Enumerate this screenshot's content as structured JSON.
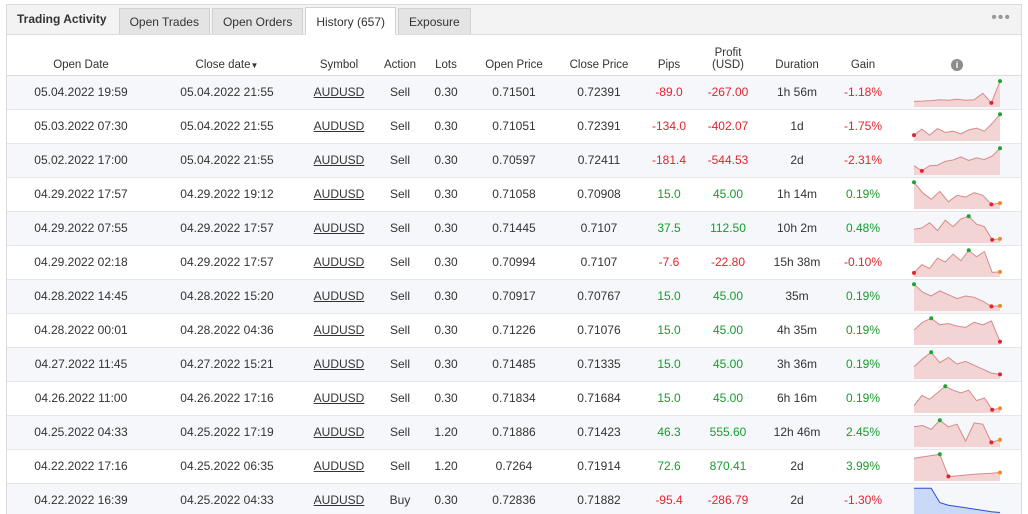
{
  "header": {
    "title": "Trading Activity",
    "tabs": [
      {
        "label": "Open Trades"
      },
      {
        "label": "Open Orders"
      },
      {
        "label": "History (657)"
      },
      {
        "label": "Exposure"
      }
    ],
    "menu_icon": "ellipsis-icon",
    "menu_glyph": "•••"
  },
  "table": {
    "columns": {
      "open_date": "Open Date",
      "close_date": "Close date",
      "sort_glyph": "▼",
      "symbol": "Symbol",
      "action": "Action",
      "lots": "Lots",
      "open_price": "Open Price",
      "close_price": "Close Price",
      "pips": "Pips",
      "profit_line1": "Profit",
      "profit_line2": "(USD)",
      "duration": "Duration",
      "gain": "Gain",
      "info_glyph": "i"
    },
    "rows": [
      {
        "open": "05.04.2022 19:59",
        "close": "05.04.2022 21:55",
        "symbol": "AUDUSD",
        "action": "Sell",
        "lots": "0.30",
        "open_price": "0.71501",
        "close_price": "0.72391",
        "pips": "-89.0",
        "profit": "-267.00",
        "duration": "1h 56m",
        "gain": "-1.18%",
        "positive": false,
        "spark": [
          0.86,
          0.85,
          0.83,
          0.8,
          0.82,
          0.78,
          0.82,
          0.8,
          0.55,
          0.92,
          0.08
        ]
      },
      {
        "open": "05.03.2022 07:30",
        "close": "05.04.2022 21:55",
        "symbol": "AUDUSD",
        "action": "Sell",
        "lots": "0.30",
        "open_price": "0.71051",
        "close_price": "0.72391",
        "pips": "-134.0",
        "profit": "-402.07",
        "duration": "1d",
        "gain": "-1.75%",
        "positive": false,
        "spark": [
          0.85,
          0.62,
          0.85,
          0.6,
          0.75,
          0.7,
          0.8,
          0.65,
          0.58,
          0.7,
          0.4,
          0.05
        ]
      },
      {
        "open": "05.02.2022 17:00",
        "close": "05.04.2022 21:55",
        "symbol": "AUDUSD",
        "action": "Sell",
        "lots": "0.30",
        "open_price": "0.70597",
        "close_price": "0.72411",
        "pips": "-181.4",
        "profit": "-544.53",
        "duration": "2d",
        "gain": "-2.31%",
        "positive": false,
        "spark": [
          0.72,
          0.92,
          0.72,
          0.7,
          0.55,
          0.5,
          0.38,
          0.52,
          0.42,
          0.48,
          0.35,
          0.05
        ]
      },
      {
        "open": "04.29.2022 17:57",
        "close": "04.29.2022 19:12",
        "symbol": "AUDUSD",
        "action": "Sell",
        "lots": "0.30",
        "open_price": "0.71058",
        "close_price": "0.70908",
        "pips": "15.0",
        "profit": "45.00",
        "duration": "1h 14m",
        "gain": "0.19%",
        "positive": true,
        "spark": [
          0.05,
          0.45,
          0.7,
          0.4,
          0.8,
          0.55,
          0.62,
          0.45,
          0.55,
          0.9,
          0.85
        ]
      },
      {
        "open": "04.29.2022 07:55",
        "close": "04.29.2022 17:57",
        "symbol": "AUDUSD",
        "action": "Sell",
        "lots": "0.30",
        "open_price": "0.71445",
        "close_price": "0.7107",
        "pips": "37.5",
        "profit": "112.50",
        "duration": "10h 2m",
        "gain": "0.48%",
        "positive": true,
        "spark": [
          0.55,
          0.5,
          0.3,
          0.6,
          0.2,
          0.45,
          0.15,
          0.05,
          0.35,
          0.45,
          0.95,
          0.92
        ]
      },
      {
        "open": "04.29.2022 02:18",
        "close": "04.29.2022 17:57",
        "symbol": "AUDUSD",
        "action": "Sell",
        "lots": "0.30",
        "open_price": "0.70994",
        "close_price": "0.7107",
        "pips": "-7.6",
        "profit": "-22.80",
        "duration": "15h 38m",
        "gain": "-0.10%",
        "positive": false,
        "spark": [
          0.92,
          0.6,
          0.75,
          0.35,
          0.5,
          0.2,
          0.45,
          0.05,
          0.3,
          0.1,
          0.9,
          0.88
        ]
      },
      {
        "open": "04.28.2022 14:45",
        "close": "04.28.2022 15:20",
        "symbol": "AUDUSD",
        "action": "Sell",
        "lots": "0.30",
        "open_price": "0.70917",
        "close_price": "0.70767",
        "pips": "15.0",
        "profit": "45.00",
        "duration": "35m",
        "gain": "0.19%",
        "positive": true,
        "spark": [
          0.05,
          0.35,
          0.5,
          0.3,
          0.45,
          0.6,
          0.5,
          0.55,
          0.7,
          0.9,
          0.88
        ]
      },
      {
        "open": "04.28.2022 00:01",
        "close": "04.28.2022 04:36",
        "symbol": "AUDUSD",
        "action": "Sell",
        "lots": "0.30",
        "open_price": "0.71226",
        "close_price": "0.71076",
        "pips": "15.0",
        "profit": "45.00",
        "duration": "4h 35m",
        "gain": "0.19%",
        "positive": true,
        "spark": [
          0.5,
          0.2,
          0.05,
          0.3,
          0.25,
          0.35,
          0.4,
          0.2,
          0.3,
          0.15,
          0.95
        ]
      },
      {
        "open": "04.27.2022 11:45",
        "close": "04.27.2022 15:21",
        "symbol": "AUDUSD",
        "action": "Sell",
        "lots": "0.30",
        "open_price": "0.71485",
        "close_price": "0.71335",
        "pips": "15.0",
        "profit": "45.00",
        "duration": "3h 36m",
        "gain": "0.19%",
        "positive": true,
        "spark": [
          0.6,
          0.3,
          0.05,
          0.45,
          0.25,
          0.5,
          0.4,
          0.55,
          0.7,
          0.85,
          0.9
        ]
      },
      {
        "open": "04.26.2022 11:00",
        "close": "04.26.2022 17:16",
        "symbol": "AUDUSD",
        "action": "Sell",
        "lots": "0.30",
        "open_price": "0.71834",
        "close_price": "0.71684",
        "pips": "15.0",
        "profit": "45.00",
        "duration": "6h 16m",
        "gain": "0.19%",
        "positive": true,
        "spark": [
          0.8,
          0.4,
          0.55,
          0.3,
          0.05,
          0.2,
          0.3,
          0.2,
          0.6,
          0.5,
          0.95,
          0.9
        ]
      },
      {
        "open": "04.25.2022 04:33",
        "close": "04.25.2022 17:19",
        "symbol": "AUDUSD",
        "action": "Sell",
        "lots": "1.20",
        "open_price": "0.71886",
        "close_price": "0.71423",
        "pips": "46.3",
        "profit": "555.60",
        "duration": "12h 46m",
        "gain": "2.45%",
        "positive": true,
        "spark": [
          0.3,
          0.25,
          0.4,
          0.05,
          0.3,
          0.2,
          0.85,
          0.15,
          0.2,
          0.9,
          0.8
        ]
      },
      {
        "open": "04.22.2022 17:16",
        "close": "04.25.2022 06:35",
        "symbol": "AUDUSD",
        "action": "Sell",
        "lots": "1.20",
        "open_price": "0.7264",
        "close_price": "0.71914",
        "pips": "72.6",
        "profit": "870.41",
        "duration": "2d",
        "gain": "3.99%",
        "positive": true,
        "spark": [
          0.2,
          0.15,
          0.1,
          0.05,
          0.9,
          0.88,
          0.85,
          0.82,
          0.8,
          0.78,
          0.75
        ]
      },
      {
        "open": "04.22.2022 16:39",
        "close": "04.25.2022 04:33",
        "symbol": "AUDUSD",
        "action": "Buy",
        "lots": "0.30",
        "open_price": "0.72836",
        "close_price": "0.71882",
        "pips": "-95.4",
        "profit": "-286.79",
        "duration": "2d",
        "gain": "-1.30%",
        "positive": false,
        "spark": [
          0.05,
          0.05,
          0.05,
          0.6,
          0.7,
          0.75,
          0.8,
          0.85,
          0.9,
          0.95,
          0.98
        ],
        "blue": true
      }
    ]
  },
  "colors": {
    "negative": "#e0252e",
    "positive": "#169d2f",
    "spark_fill": "#f2d4d4",
    "spark_line": "#d98a8a",
    "spark_blue_fill": "#c9d9f7",
    "spark_blue_line": "#2a4fd6",
    "spark_end_red": "#e0252e",
    "spark_end_green": "#1ea334",
    "spark_end_orange": "#f08a24"
  }
}
